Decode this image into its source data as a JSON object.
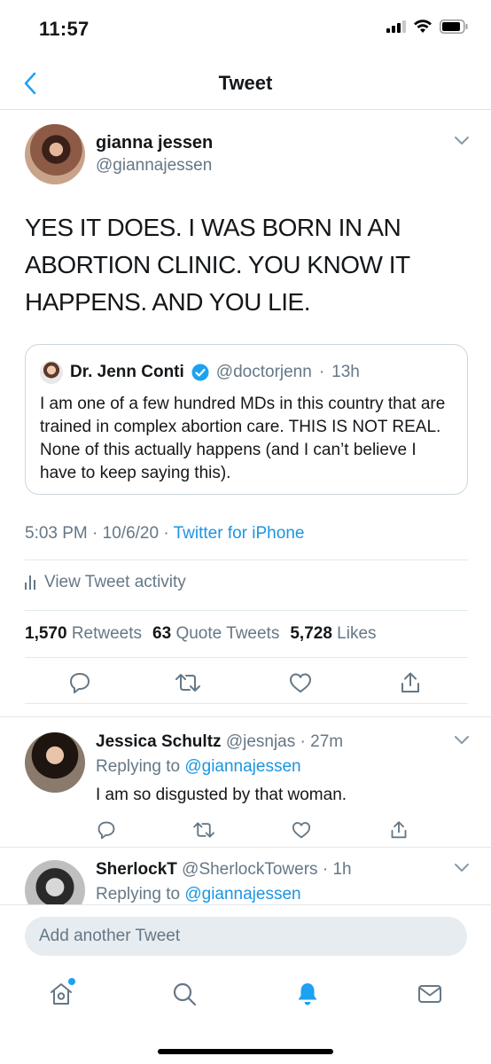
{
  "status_bar": {
    "time": "11:57"
  },
  "nav": {
    "title": "Tweet"
  },
  "tweet": {
    "author_name": "gianna jessen",
    "author_handle": "@giannajessen",
    "text": "YES IT DOES. I WAS BORN IN AN ABORTION CLINIC. YOU KNOW IT HAPPENS. AND YOU LIE.",
    "quote": {
      "name": "Dr. Jenn Conti",
      "handle": "@doctorjenn",
      "time": "13h",
      "text": "I am one of a few hundred MDs in this country that are trained in complex abortion care. THIS IS NOT REAL. None of this actually happens (and I can’t believe I have to keep saying this)."
    },
    "time": "5:03 PM",
    "date": "10/6/20",
    "source": "Twitter for iPhone",
    "activity_label": "View Tweet activity",
    "stats": {
      "retweets_count": "1,570",
      "retweets_label": "Retweets",
      "quotes_count": "63",
      "quotes_label": "Quote Tweets",
      "likes_count": "5,728",
      "likes_label": "Likes"
    }
  },
  "replies": [
    {
      "name": "Jessica Schultz",
      "handle": "@jesnjas",
      "time": "27m",
      "replying_prefix": "Replying to",
      "replying_to": "@giannajessen",
      "text": "I am so disgusted by that woman."
    },
    {
      "name": "SherlockT",
      "handle": "@SherlockTowers",
      "time": "1h",
      "replying_prefix": "Replying to",
      "replying_to": "@giannajessen"
    }
  ],
  "compose": {
    "placeholder": "Add another Tweet"
  },
  "colors": {
    "accent": "#1da1f2",
    "link": "#1b95e0",
    "secondary_text": "#657786",
    "border": "#e1e8ed"
  },
  "tabbar": {
    "icons": [
      "home-icon",
      "search-icon",
      "notifications-icon",
      "messages-icon"
    ],
    "active": "notifications-icon"
  }
}
